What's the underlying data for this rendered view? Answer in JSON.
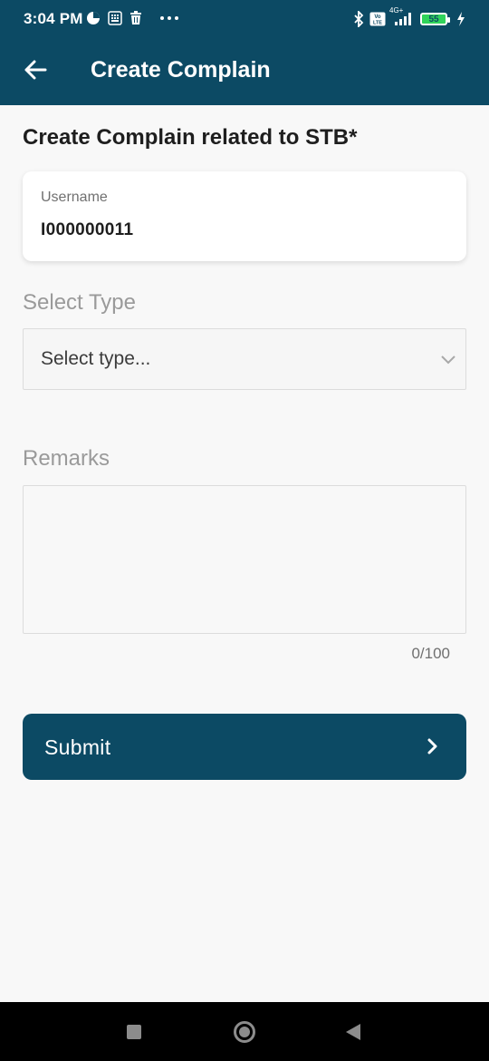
{
  "status_bar": {
    "time": "3:04 PM",
    "network_label": "4G+",
    "volte_label": "Vo LTE",
    "battery_level": "55"
  },
  "header": {
    "title": "Create Complain"
  },
  "form": {
    "section_title": "Create Complain related to STB*",
    "username_label": "Username",
    "username_value": "I000000011",
    "type_label": "Select Type",
    "type_placeholder": "Select type...",
    "remarks_label": "Remarks",
    "remarks_value": "",
    "remarks_counter": "0/100",
    "submit_label": "Submit"
  },
  "colors": {
    "primary": "#0c4a64",
    "background": "#f8f8f8"
  }
}
